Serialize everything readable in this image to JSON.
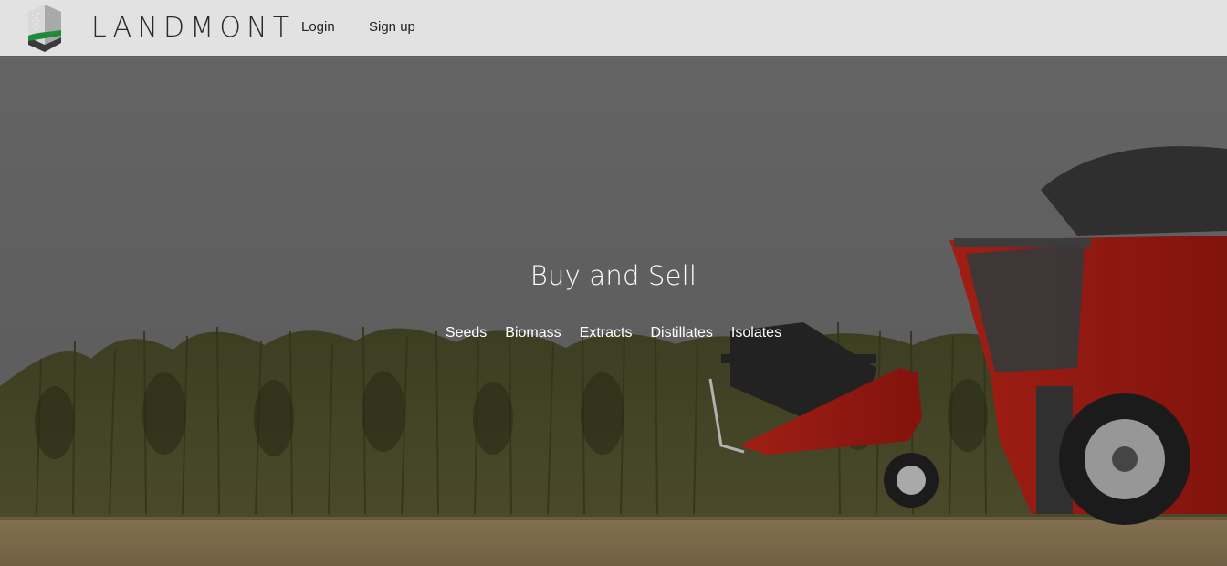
{
  "brand": {
    "name": "LANDMONT",
    "logo_icon": "landmont-logo-icon"
  },
  "nav": {
    "login_label": "Login",
    "signup_label": "Sign up"
  },
  "hero": {
    "title": "Buy and Sell",
    "categories": [
      "Seeds",
      "Biomass",
      "Extracts",
      "Distillates",
      "Isolates"
    ],
    "background": "combine harvester in hemp field"
  },
  "colors": {
    "header_bg": "#e2e2e2",
    "logo_green": "#1e8a3a",
    "harvester_red": "#b41e14",
    "sky": "#737373",
    "text_on_hero": "#ffffff"
  }
}
